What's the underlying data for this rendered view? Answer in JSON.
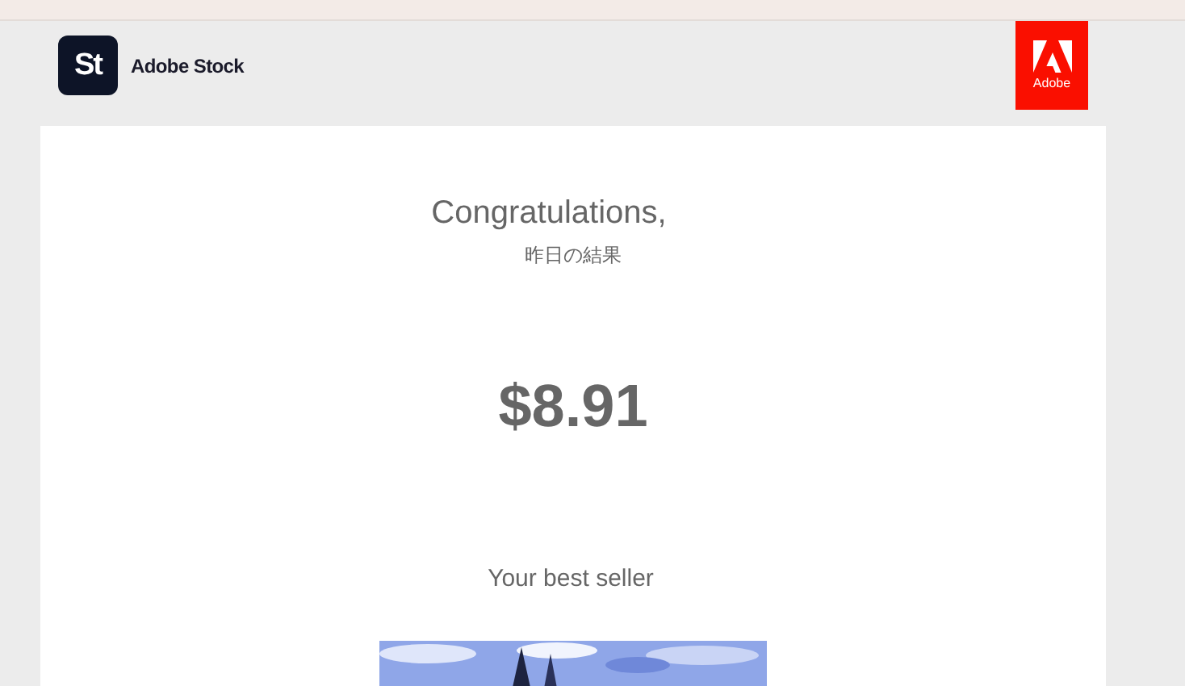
{
  "header": {
    "app_logo": "St",
    "app_name": "Adobe Stock",
    "brand_logo": "Adobe"
  },
  "email": {
    "greeting": "Congratulations,",
    "subtitle": "昨日の結果",
    "amount": "$8.91",
    "best_seller_label": "Your best seller"
  }
}
